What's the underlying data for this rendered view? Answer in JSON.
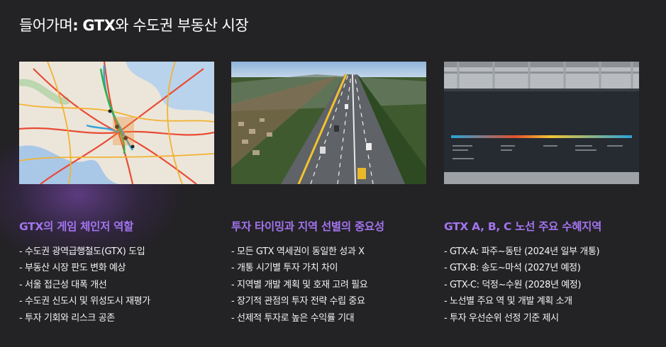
{
  "title": {
    "prefix": "들어가며",
    "sep": ":",
    "brand": "GTX",
    "rest": "와 수도권 부동산 시장"
  },
  "colors": {
    "background": "#232225",
    "accent": "#a274ee",
    "text": "#ffffff"
  },
  "cards": [
    {
      "image": "metro-network-map",
      "heading": "GTX의 게임 체인저 역할",
      "items": [
        "수도권 광역급행철도(GTX) 도입",
        "부동산 시장 판도 변화 예상",
        "서울 접근성 대폭 개선",
        "수도권 신도시 및 위성도시 재평가",
        "투자 기회와 리스크 공존"
      ]
    },
    {
      "image": "highway-aerial-photo",
      "heading": "투자 타이밍과 지역 선별의 중요성",
      "items": [
        "모든 GTX 역세권이 동일한 성과 X",
        "개통 시기별 투자 가치 차이",
        "지역별 개발 계획 및 호재 고려 필요",
        "장기적 관점의 투자 전략 수립 중요",
        "선제적 투자로 높은 수익률 기대"
      ]
    },
    {
      "image": "station-timeline-display",
      "heading": "GTX A, B, C 노선 주요 수혜지역",
      "items": [
        "GTX-A: 파주~동탄 (2024년 일부 개통)",
        "GTX-B: 송도~마석 (2027년 예정)",
        "GTX-C: 덕정~수원 (2028년 예정)",
        "노선별 주요 역 및 개발 계획 소개",
        "투자 우선순위 선정 기준 제시"
      ]
    }
  ]
}
